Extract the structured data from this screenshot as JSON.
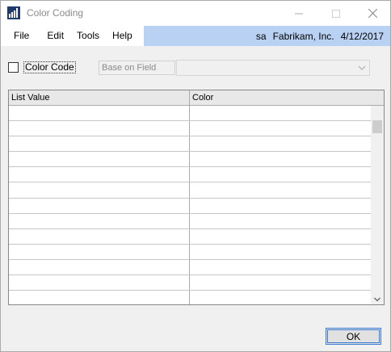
{
  "window": {
    "title": "Color Coding"
  },
  "menu": {
    "items": [
      "File",
      "Edit",
      "Tools",
      "Help"
    ],
    "user": "sa",
    "company": "Fabrikam, Inc.",
    "date": "4/12/2017"
  },
  "options": {
    "color_code_label": "Color Code",
    "color_code_checked": false,
    "base_on_field_label": "Base on Field",
    "base_on_field_value": ""
  },
  "grid": {
    "columns": [
      "List Value",
      "Color"
    ],
    "rows": [
      [
        "",
        ""
      ],
      [
        "",
        ""
      ],
      [
        "",
        ""
      ],
      [
        "",
        ""
      ],
      [
        "",
        ""
      ],
      [
        "",
        ""
      ],
      [
        "",
        ""
      ],
      [
        "",
        ""
      ],
      [
        "",
        ""
      ],
      [
        "",
        ""
      ],
      [
        "",
        ""
      ],
      [
        "",
        ""
      ],
      [
        "",
        ""
      ]
    ]
  },
  "buttons": {
    "ok_label": "OK"
  }
}
